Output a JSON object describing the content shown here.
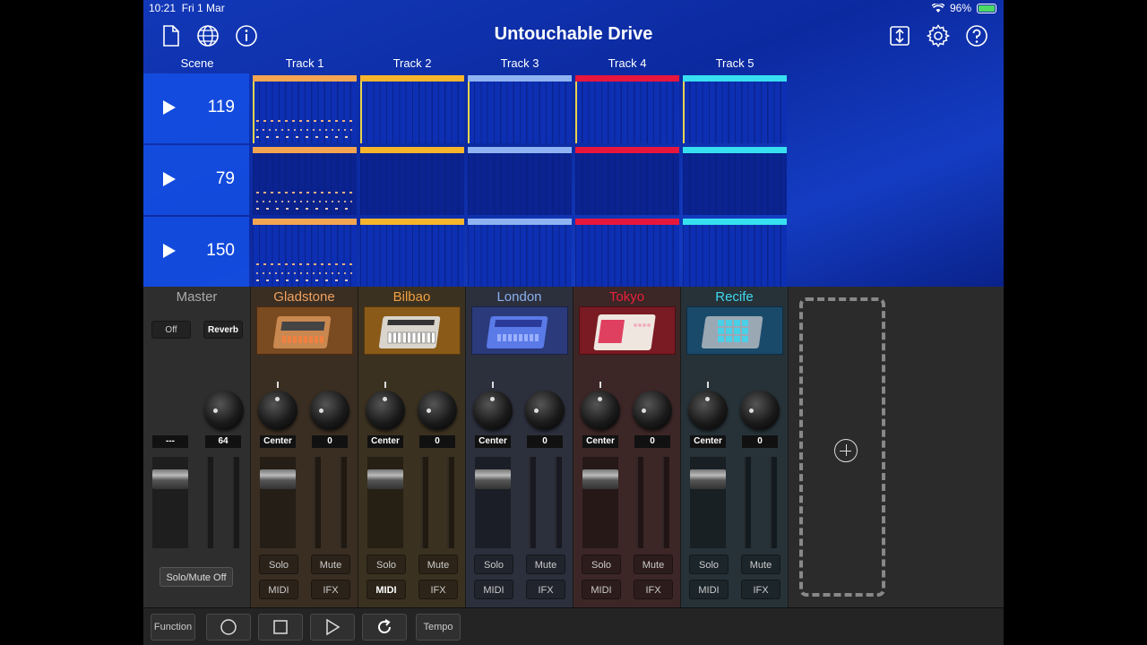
{
  "status": {
    "time": "10:21",
    "date": "Fri 1 Mar",
    "battery": "96%"
  },
  "title": "Untouchable Drive",
  "headers": {
    "scene": "Scene",
    "tracks": [
      "Track 1",
      "Track 2",
      "Track 3",
      "Track 4",
      "Track 5"
    ]
  },
  "scenes": [
    "119",
    "79",
    "150"
  ],
  "track_colors": [
    "#f3a552",
    "#f7b52c",
    "#8fb3f2",
    "#e8163d",
    "#37e0f0"
  ],
  "master": {
    "label": "Master",
    "off_label": "Off",
    "reverb_label": "Reverb",
    "pan_value": "---",
    "knob_value": "64",
    "solo_mute_off": "Solo/Mute Off"
  },
  "channels": [
    {
      "name": "Gladstone",
      "name_color": "#f0a060",
      "pan": "Center",
      "send": "0",
      "solo": "Solo",
      "mute": "Mute",
      "midi": "MIDI",
      "ifx": "IFX",
      "midi_active": false
    },
    {
      "name": "Bilbao",
      "name_color": "#f0a040",
      "pan": "Center",
      "send": "0",
      "solo": "Solo",
      "mute": "Mute",
      "midi": "MIDI",
      "ifx": "IFX",
      "midi_active": true
    },
    {
      "name": "London",
      "name_color": "#8ab0f0",
      "pan": "Center",
      "send": "0",
      "solo": "Solo",
      "mute": "Mute",
      "midi": "MIDI",
      "ifx": "IFX",
      "midi_active": false
    },
    {
      "name": "Tokyo",
      "name_color": "#e8203c",
      "pan": "Center",
      "send": "0",
      "solo": "Solo",
      "mute": "Mute",
      "midi": "MIDI",
      "ifx": "IFX",
      "midi_active": false
    },
    {
      "name": "Recife",
      "name_color": "#40d8f0",
      "pan": "Center",
      "send": "0",
      "solo": "Solo",
      "mute": "Mute",
      "midi": "MIDI",
      "ifx": "IFX",
      "midi_active": false
    }
  ],
  "transport": {
    "function": "Function",
    "tempo": "Tempo"
  },
  "icons": {
    "top_left": [
      "document-icon",
      "globe-icon",
      "info-icon"
    ],
    "top_right": [
      "resize-icon",
      "gear-icon",
      "help-icon"
    ],
    "transport": [
      "record-icon",
      "stop-icon",
      "play-icon",
      "loop-icon"
    ]
  }
}
